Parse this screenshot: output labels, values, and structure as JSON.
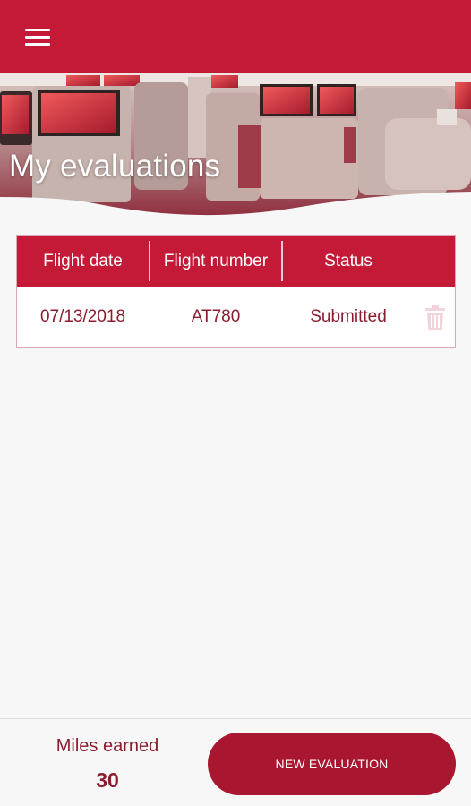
{
  "app": {
    "menu_icon": "hamburger-menu-icon",
    "accent_color": "#c41a38"
  },
  "hero": {
    "title": "My evaluations"
  },
  "table": {
    "headers": [
      "Flight date",
      "Flight number",
      "Status"
    ],
    "rows": [
      {
        "flight_date": "07/13/2018",
        "flight_number": "AT780",
        "status": "Submitted",
        "action_icon": "trash-icon"
      }
    ]
  },
  "footer": {
    "miles_label": "Miles earned",
    "miles_value": "30",
    "new_evaluation_label": "NEW EVALUATION"
  }
}
